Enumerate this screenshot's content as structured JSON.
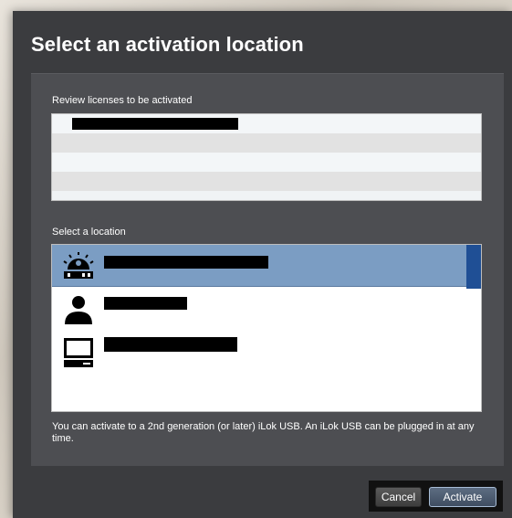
{
  "dialog": {
    "title": "Select an activation location"
  },
  "licenses": {
    "label": "Review licenses to be activated",
    "rows": [
      "",
      "",
      "",
      ""
    ]
  },
  "locations": {
    "label": "Select a location",
    "items": [
      {
        "icon": "ilok-usb-icon",
        "label": "",
        "selected": true
      },
      {
        "icon": "user-icon",
        "label": "",
        "selected": false
      },
      {
        "icon": "computer-icon",
        "label": "",
        "selected": false
      }
    ]
  },
  "notice": "You can activate to a 2nd generation (or later) iLok USB. An iLok USB can be plugged in at any time.",
  "buttons": {
    "cancel": "Cancel",
    "activate": "Activate"
  }
}
